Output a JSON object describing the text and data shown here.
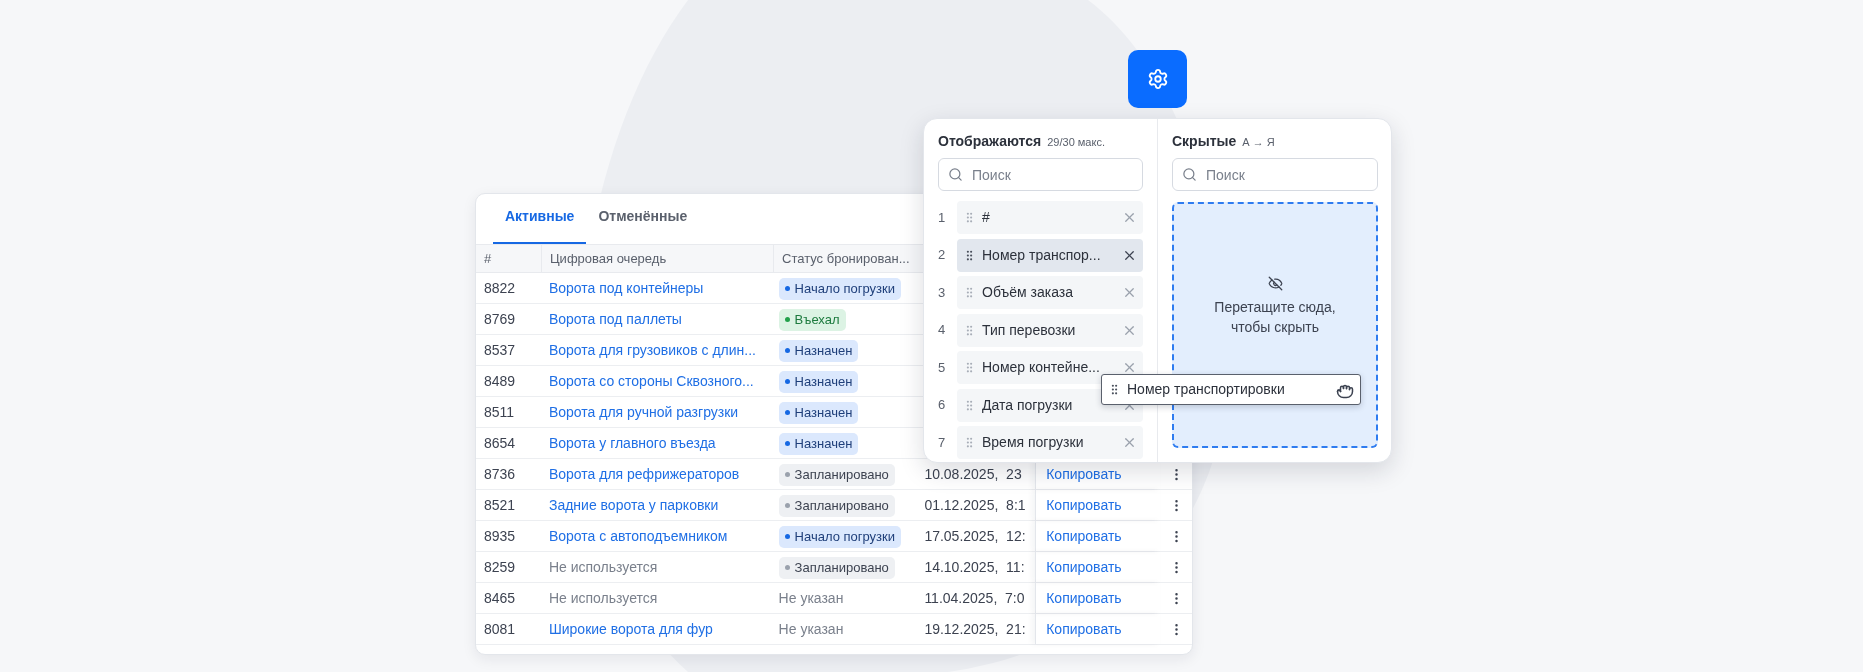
{
  "tabs": [
    {
      "label": "Активные",
      "selected": true
    },
    {
      "label": "Отменённые",
      "selected": false
    }
  ],
  "table": {
    "columns": [
      "#",
      "Цифровая очередь",
      "Статус бронирован..."
    ],
    "rows": [
      {
        "id": "8822",
        "queue": {
          "label": "Ворота под контейнеры",
          "kind": "link"
        },
        "status": {
          "label": "Начало погрузки",
          "kind": "loading"
        }
      },
      {
        "id": "8769",
        "queue": {
          "label": "Ворота под паллеты",
          "kind": "link"
        },
        "status": {
          "label": "Въехал",
          "kind": "entered"
        }
      },
      {
        "id": "8537",
        "queue": {
          "label": "Ворота для грузовиков с длин...",
          "kind": "link"
        },
        "status": {
          "label": "Назначен",
          "kind": "assigned"
        }
      },
      {
        "id": "8489",
        "queue": {
          "label": "Ворота со стороны Сквозного...",
          "kind": "link"
        },
        "status": {
          "label": "Назначен",
          "kind": "assigned"
        }
      },
      {
        "id": "8511",
        "queue": {
          "label": "Ворота для ручной разгрузки",
          "kind": "link"
        },
        "status": {
          "label": "Назначен",
          "kind": "assigned"
        }
      },
      {
        "id": "8654",
        "queue": {
          "label": "Ворота у главного въезда",
          "kind": "link"
        },
        "status": {
          "label": "Назначен",
          "kind": "assigned"
        }
      },
      {
        "id": "8736",
        "queue": {
          "label": "Ворота для рефрижераторов",
          "kind": "link"
        },
        "status": {
          "label": "Запланировано",
          "kind": "planned"
        },
        "date": "10.08.2025,  23",
        "action": "Копировать"
      },
      {
        "id": "8521",
        "queue": {
          "label": "Задние ворота у парковки",
          "kind": "link"
        },
        "status": {
          "label": "Запланировано",
          "kind": "planned"
        },
        "date": "01.12.2025,  8:1",
        "action": "Копировать"
      },
      {
        "id": "8935",
        "queue": {
          "label": "Ворота с автоподъемником",
          "kind": "link"
        },
        "status": {
          "label": "Начало погрузки",
          "kind": "loading"
        },
        "date": "17.05.2025,  12:",
        "action": "Копировать"
      },
      {
        "id": "8259",
        "queue": {
          "label": "Не используется",
          "kind": "muted"
        },
        "status": {
          "label": "Запланировано",
          "kind": "planned"
        },
        "date": "14.10.2025,  11:",
        "action": "Копировать"
      },
      {
        "id": "8465",
        "queue": {
          "label": "Не используется",
          "kind": "muted"
        },
        "status": {
          "label": "Не указан",
          "kind": "none"
        },
        "date": "11.04.2025,  7:0",
        "action": "Копировать"
      },
      {
        "id": "8081",
        "queue": {
          "label": "Широкие ворота для фур",
          "kind": "link"
        },
        "status": {
          "label": "Не указан",
          "kind": "none"
        },
        "date": "19.12.2025,  21:",
        "action": "Копировать"
      }
    ]
  },
  "columns_panel": {
    "shown": {
      "title": "Отображаются",
      "count": "29/30 макс.",
      "search_placeholder": "Поиск",
      "items": [
        {
          "index": "1",
          "label": "#",
          "selected": false
        },
        {
          "index": "2",
          "label": "Номер транспор...",
          "selected": true
        },
        {
          "index": "3",
          "label": "Объём заказа",
          "selected": false
        },
        {
          "index": "4",
          "label": "Тип перевозки",
          "selected": false
        },
        {
          "index": "5",
          "label": "Номер контейне...",
          "selected": false
        },
        {
          "index": "6",
          "label": "Дата погрузки",
          "selected": false
        },
        {
          "index": "7",
          "label": "Время погрузки",
          "selected": false
        }
      ]
    },
    "hidden": {
      "title": "Скрытые",
      "sort": "А → Я",
      "search_placeholder": "Поиск",
      "drop_hint": "Перетащите сюда, чтобы скрыть"
    },
    "drag_ghost": {
      "label": "Номер транспортировки"
    }
  }
}
